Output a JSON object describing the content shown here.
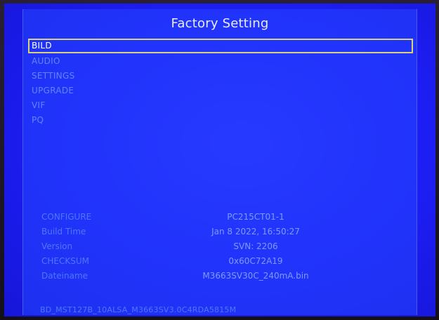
{
  "title": "Factory Setting",
  "menu": {
    "items": [
      {
        "label": "BILD",
        "selected": true
      },
      {
        "label": "AUDIO",
        "selected": false
      },
      {
        "label": "SETTINGS",
        "selected": false
      },
      {
        "label": "UPGRADE",
        "selected": false
      },
      {
        "label": "VIF",
        "selected": false
      },
      {
        "label": "PQ",
        "selected": false
      }
    ]
  },
  "info": {
    "rows": [
      {
        "label": "CONFIGURE",
        "value": "PC215CT01-1"
      },
      {
        "label": "Build Time",
        "value": "Jan  8 2022, 16:50:27"
      },
      {
        "label": "Version",
        "value": "SVN: 2206"
      },
      {
        "label": "CHECKSUM",
        "value": "0x60C72A19"
      },
      {
        "label": "Dateiname",
        "value": "M3663SV30C_240mA.bin"
      }
    ]
  },
  "footer": "BD_MST127B_10ALSA_M3663SV3.0C4RDA5815M",
  "colors": {
    "background": "#1d1ef4",
    "selection_border": "#d9d27a",
    "text_dim": "#5f86ff",
    "text_bright": "#ffffff"
  }
}
